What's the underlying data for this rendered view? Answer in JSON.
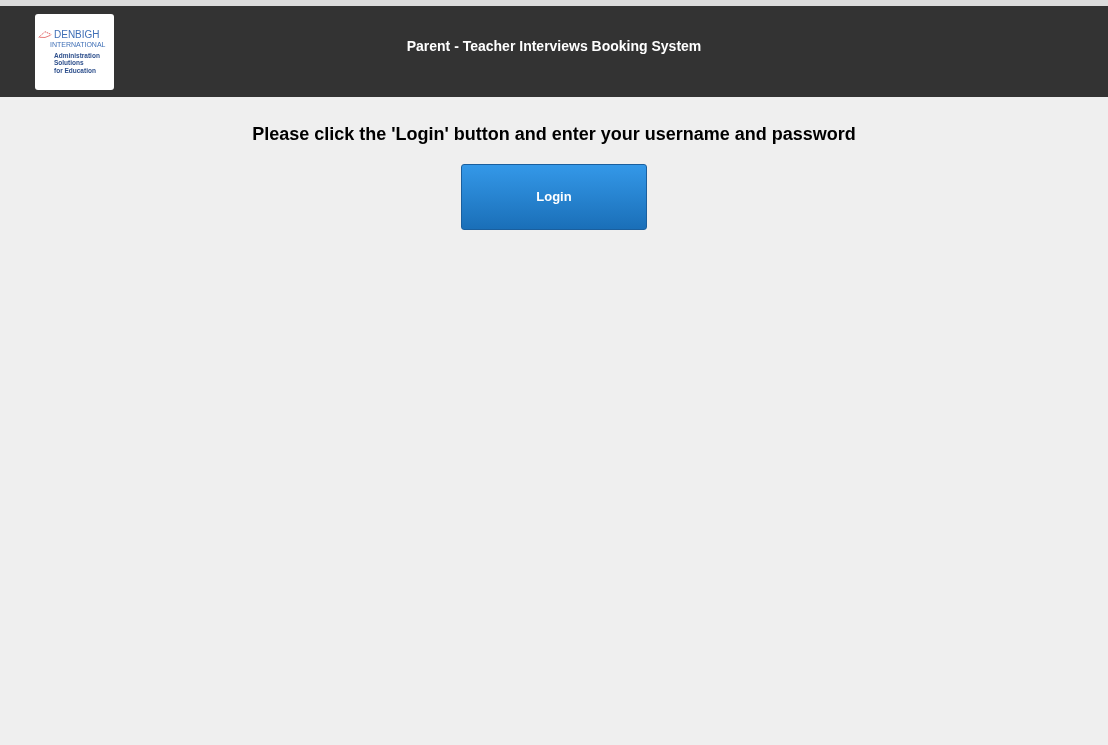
{
  "header": {
    "logo": {
      "brand": "DENBIGH",
      "subbrand": "INTERNATIONAL",
      "tagline": [
        "Administration",
        "Solutions",
        "for Education"
      ]
    },
    "title": "Parent - Teacher Interviews Booking System"
  },
  "main": {
    "instruction": "Please click the 'Login' button and enter your username and password",
    "button": "Login"
  }
}
